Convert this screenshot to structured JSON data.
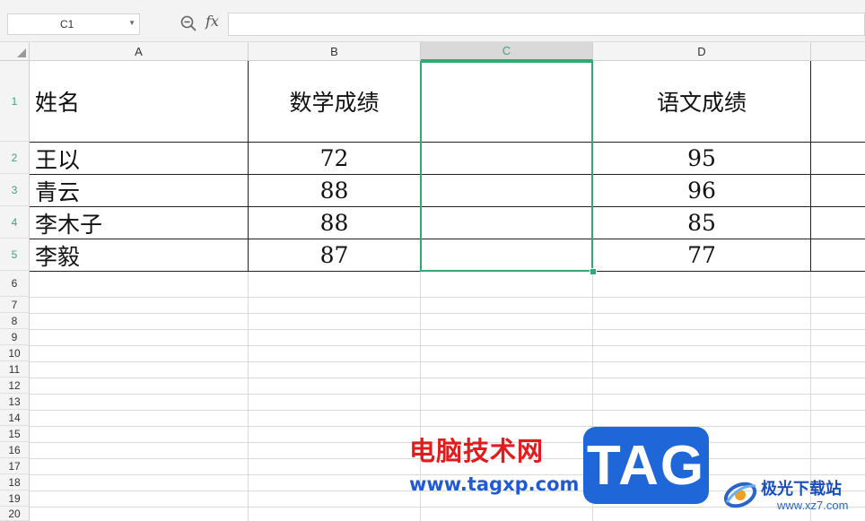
{
  "formula_bar": {
    "name_box": "C1",
    "fx_label": "fx",
    "formula_value": ""
  },
  "columns": [
    "A",
    "B",
    "C",
    "D"
  ],
  "selected_column": "C",
  "rows": [
    "1",
    "2",
    "3",
    "4",
    "5",
    "6",
    "7",
    "8",
    "9",
    "10",
    "11",
    "12",
    "13",
    "14",
    "15",
    "16",
    "17",
    "18",
    "19",
    "20"
  ],
  "table": {
    "headers": {
      "name": "姓名",
      "math": "数学成绩",
      "chinese": "语文成绩"
    },
    "records": [
      {
        "name": "王以",
        "math": "72",
        "chinese": "95"
      },
      {
        "name": "青云",
        "math": "88",
        "chinese": "96"
      },
      {
        "name": "李木子",
        "math": "88",
        "chinese": "85"
      },
      {
        "name": "李毅",
        "math": "87",
        "chinese": "77"
      }
    ]
  },
  "watermark": {
    "site_name": "电脑技术网",
    "site_url": "www.tagxp.com",
    "tag_logo": "TAG",
    "xz_name": "极光下载站",
    "xz_url": "www.xz7.com"
  },
  "colors": {
    "selection": "#2eaa72",
    "watermark_red": "#e21c1c",
    "watermark_blue": "#1f67d8"
  }
}
